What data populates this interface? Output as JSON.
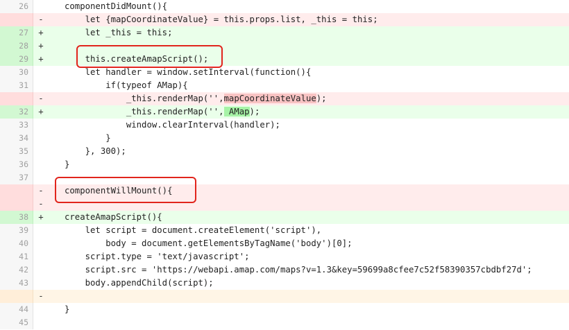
{
  "diff": {
    "rows": [
      {
        "num": "26",
        "sign": "",
        "type": "ctx",
        "indent": 0,
        "text": "componentDidMount(){"
      },
      {
        "num": "",
        "sign": "-",
        "type": "del",
        "indent": 4,
        "text": "let {mapCoordinateValue} = this.props.list, _this = this;"
      },
      {
        "num": "27",
        "sign": "+",
        "type": "add",
        "indent": 4,
        "text": "let _this = this;"
      },
      {
        "num": "28",
        "sign": "+",
        "type": "add",
        "indent": 0,
        "text": ""
      },
      {
        "num": "29",
        "sign": "+",
        "type": "add",
        "indent": 4,
        "text": "this.createAmapScript();"
      },
      {
        "num": "30",
        "sign": "",
        "type": "ctx",
        "indent": 4,
        "text": "let handler = window.setInterval(function(){"
      },
      {
        "num": "31",
        "sign": "",
        "type": "ctx",
        "indent": 8,
        "text": "if(typeof AMap){"
      },
      {
        "num": "",
        "sign": "-",
        "type": "del",
        "indent": 12,
        "pre": "_this.renderMap('',",
        "hl": "mapCoordinateValue",
        "post": ");"
      },
      {
        "num": "32",
        "sign": "+",
        "type": "add",
        "indent": 12,
        "pre": "_this.renderMap('',",
        "hl": " AMap",
        "post": ");"
      },
      {
        "num": "33",
        "sign": "",
        "type": "ctx",
        "indent": 12,
        "text": "window.clearInterval(handler);"
      },
      {
        "num": "34",
        "sign": "",
        "type": "ctx",
        "indent": 8,
        "text": "}"
      },
      {
        "num": "35",
        "sign": "",
        "type": "ctx",
        "indent": 4,
        "text": "}, 300);"
      },
      {
        "num": "36",
        "sign": "",
        "type": "ctx",
        "indent": 0,
        "text": "}"
      },
      {
        "num": "37",
        "sign": "",
        "type": "ctx",
        "indent": 0,
        "text": ""
      },
      {
        "num": "",
        "sign": "-",
        "type": "del",
        "indent": 0,
        "text": "componentWillMount(){"
      },
      {
        "num": "",
        "sign": "-",
        "type": "del",
        "indent": 0,
        "text": ""
      },
      {
        "num": "38",
        "sign": "+",
        "type": "add",
        "indent": 0,
        "text": "createAmapScript(){"
      },
      {
        "num": "39",
        "sign": "",
        "type": "ctx",
        "indent": 4,
        "text": "let script = document.createElement('script'),"
      },
      {
        "num": "40",
        "sign": "",
        "type": "ctx",
        "indent": 8,
        "text": "body = document.getElementsByTagName('body')[0];"
      },
      {
        "num": "41",
        "sign": "",
        "type": "ctx",
        "indent": 4,
        "text": "script.type = 'text/javascript';"
      },
      {
        "num": "42",
        "sign": "",
        "type": "ctx",
        "indent": 4,
        "text": "script.src = 'https://webapi.amap.com/maps?v=1.3&key=59699a8cfee7c52f58390357cbdbf27d';"
      },
      {
        "num": "43",
        "sign": "",
        "type": "ctx",
        "indent": 4,
        "text": "body.appendChild(script);"
      },
      {
        "num": "",
        "sign": "-",
        "type": "warn",
        "indent": 0,
        "text": ""
      },
      {
        "num": "44",
        "sign": "",
        "type": "ctx",
        "indent": 0,
        "text": "}"
      },
      {
        "num": "45",
        "sign": "",
        "type": "ctx",
        "indent": 0,
        "text": ""
      }
    ]
  },
  "colors": {
    "added_bg": "#eaffea",
    "removed_bg": "#ffecec",
    "callout_border": "#e1241c"
  }
}
